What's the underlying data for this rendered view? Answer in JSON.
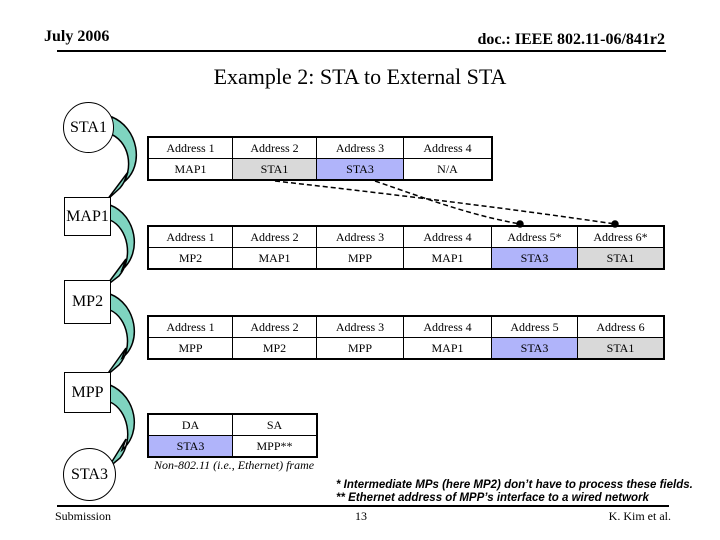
{
  "header": {
    "date": "July 2006",
    "doc_id": "doc.: IEEE 802.11-06/841r2"
  },
  "title": "Example 2: STA to External STA",
  "nodes": {
    "sta1": "STA1",
    "map1": "MAP1",
    "mp2": "MP2",
    "mpp": "MPP",
    "sta3": "STA3"
  },
  "frame1": {
    "headers": [
      "Address 1",
      "Address 2",
      "Address 3",
      "Address 4"
    ],
    "values": [
      "MAP1",
      "STA1",
      "STA3",
      "N/A"
    ]
  },
  "frame2": {
    "headers": [
      "Address 1",
      "Address 2",
      "Address 3",
      "Address 4",
      "Address 5*",
      "Address 6*"
    ],
    "values": [
      "MP2",
      "MAP1",
      "MPP",
      "MAP1",
      "STA3",
      "STA1"
    ]
  },
  "frame3": {
    "headers": [
      "Address 1",
      "Address 2",
      "Address 3",
      "Address 4",
      "Address 5",
      "Address 6"
    ],
    "values": [
      "MPP",
      "MP2",
      "MPP",
      "MAP1",
      "STA3",
      "STA1"
    ]
  },
  "frame4": {
    "headers": [
      "DA",
      "SA"
    ],
    "values": [
      "STA3",
      "MPP**"
    ],
    "caption": "Non-802.11 (i.e., Ethernet) frame"
  },
  "notes": {
    "note1": "* Intermediate MPs (here MP2) don’t have to process these fields.",
    "note2": "** Ethernet address of MPP’s interface to a wired network"
  },
  "footer": {
    "left": "Submission",
    "page": "13",
    "author": "K. Kim et al."
  },
  "colors": {
    "sta3_fill": "#b0b4fa",
    "sta1_fill": "#d9d9d9",
    "arrow_fill": "#7fd4c0"
  }
}
